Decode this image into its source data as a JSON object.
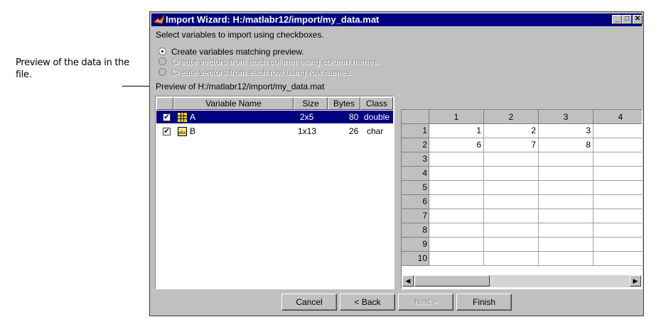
{
  "callout": {
    "text": "Preview of the data in the file."
  },
  "window": {
    "title": "Import Wizard: H:/matlabr12/import/my_data.mat",
    "instructions": "Select variables to import using checkboxes.",
    "options": [
      {
        "label": "Create variables matching preview.",
        "selected": true,
        "enabled": true
      },
      {
        "label": "Create vectors from each column using column names.",
        "selected": false,
        "enabled": false
      },
      {
        "label": "Create vectors from each row using row names.",
        "selected": false,
        "enabled": false
      }
    ],
    "preview_label": "Preview of H:/matlabr12/import/my_data.mat"
  },
  "variables": {
    "headers": [
      "Variable Name",
      "Size",
      "Bytes",
      "Class"
    ],
    "rows": [
      {
        "name": "A",
        "size": "2x5",
        "bytes": "80",
        "class": "double",
        "icon": "matrix-icon",
        "checked": true,
        "selected": true
      },
      {
        "name": "B",
        "size": "1x13",
        "bytes": "26",
        "class": "char",
        "icon": "abc-icon",
        "checked": true,
        "selected": false
      }
    ]
  },
  "grid": {
    "column_headers": [
      "1",
      "2",
      "3",
      "4"
    ],
    "row_headers": [
      "1",
      "2",
      "3",
      "4",
      "5",
      "6",
      "7",
      "8",
      "9",
      "10"
    ],
    "cells": [
      [
        "1",
        "2",
        "3",
        ""
      ],
      [
        "6",
        "7",
        "8",
        ""
      ],
      [
        "",
        "",
        "",
        ""
      ],
      [
        "",
        "",
        "",
        ""
      ],
      [
        "",
        "",
        "",
        ""
      ],
      [
        "",
        "",
        "",
        ""
      ],
      [
        "",
        "",
        "",
        ""
      ],
      [
        "",
        "",
        "",
        ""
      ],
      [
        "",
        "",
        "",
        ""
      ],
      [
        "",
        "",
        "",
        ""
      ]
    ]
  },
  "buttons": {
    "cancel": "Cancel",
    "back": "< Back",
    "next": "Next >",
    "finish": "Finish"
  },
  "colors": {
    "titlebar": "#000080",
    "selection": "#000080",
    "face": "#c0c0c0"
  }
}
